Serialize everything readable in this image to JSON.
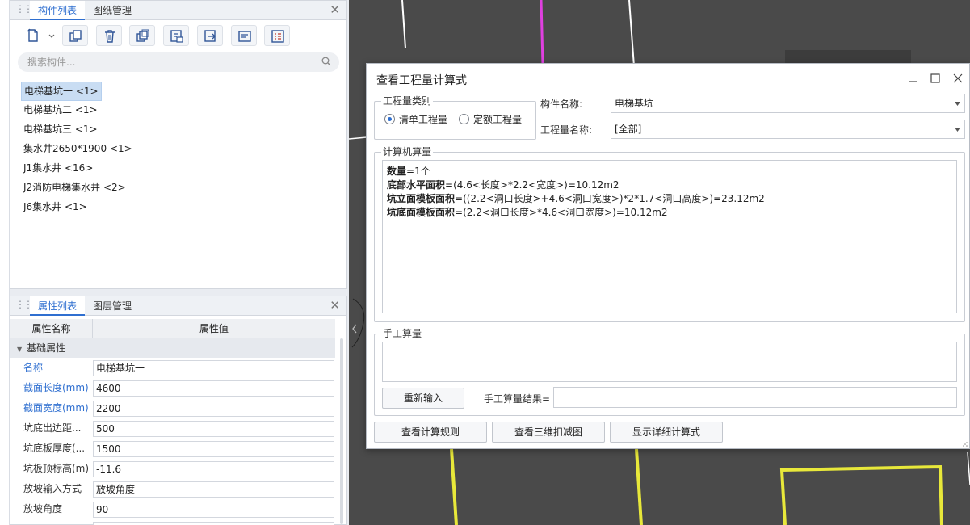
{
  "left_panel_top": {
    "tabs": [
      {
        "label": "构件列表",
        "active": true
      },
      {
        "label": "图纸管理",
        "active": false
      }
    ],
    "close_glyph": "✕",
    "toolbar_icons": [
      "new-component-icon",
      "copy-icon",
      "delete-icon",
      "duplicate-icon",
      "floor-copy-icon",
      "export-icon",
      "rename-icon",
      "properties-icon"
    ],
    "search": {
      "placeholder": "搜索构件...",
      "value": ""
    },
    "components": [
      {
        "label": "电梯基坑一 <1>",
        "selected": true
      },
      {
        "label": "电梯基坑二 <1>",
        "selected": false
      },
      {
        "label": "电梯基坑三 <1>",
        "selected": false
      },
      {
        "label": "集水井2650*1900 <1>",
        "selected": false
      },
      {
        "label": "J1集水井 <16>",
        "selected": false
      },
      {
        "label": "J2消防电梯集水井 <2>",
        "selected": false
      },
      {
        "label": "J6集水井 <1>",
        "selected": false
      }
    ]
  },
  "left_panel_bottom": {
    "tabs": [
      {
        "label": "属性列表",
        "active": true
      },
      {
        "label": "图层管理",
        "active": false
      }
    ],
    "close_glyph": "✕",
    "columns": {
      "name": "属性名称",
      "value": "属性值"
    },
    "group_label": "基础属性",
    "rows": [
      {
        "name": "名称",
        "value": "电梯基坑一",
        "highlight": true
      },
      {
        "name": "截面长度(mm)",
        "value": "4600",
        "highlight": true
      },
      {
        "name": "截面宽度(mm)",
        "value": "2200",
        "highlight": true
      },
      {
        "name": "坑底出边距...",
        "value": "500",
        "highlight": false
      },
      {
        "name": "坑底板厚度(...",
        "value": "1500",
        "highlight": false
      },
      {
        "name": "坑板顶标高(m)",
        "value": "-11.6",
        "highlight": false
      },
      {
        "name": "放坡输入方式",
        "value": "放坡角度",
        "highlight": false
      },
      {
        "name": "放坡角度",
        "value": "90",
        "highlight": false
      },
      {
        "name": "",
        "value": "",
        "highlight": false
      }
    ]
  },
  "dialog": {
    "title": "查看工程量计算式",
    "window_controls": [
      "minimize-icon",
      "maximize-icon",
      "close-icon"
    ],
    "quantity_type": {
      "legend": "工程量类别",
      "options": [
        {
          "label": "清单工程量",
          "checked": true
        },
        {
          "label": "定额工程量",
          "checked": false
        }
      ]
    },
    "component_name": {
      "label": "构件名称:",
      "value": "电梯基坑一"
    },
    "quantity_name": {
      "label": "工程量名称:",
      "value": "[全部]"
    },
    "computer_calc": {
      "legend": "计算机算量",
      "lines": [
        {
          "key": "数量",
          "formula": "=1个"
        },
        {
          "key": "底部水平面积",
          "formula": "=(4.6<长度>*2.2<宽度>)=10.12m2"
        },
        {
          "key": "坑立面模板面积",
          "formula": "=((2.2<洞口长度>+4.6<洞口宽度>)*2*1.7<洞口高度>)=23.12m2"
        },
        {
          "key": "坑底面模板面积",
          "formula": "=(2.2<洞口长度>*4.6<洞口宽度>)=10.12m2"
        }
      ]
    },
    "manual_calc": {
      "legend": "手工算量",
      "reenter_label": "重新输入",
      "result_label": "手工算量结果=",
      "result_value": ""
    },
    "buttons": {
      "view_rules": "查看计算规则",
      "view_3d": "查看三维扣减图",
      "show_detail": "显示详细计算式"
    }
  },
  "colors": {
    "accent": "#2f6fd0",
    "canvas_bg": "#4a4a4a",
    "canvas_line_white": "#ffffff",
    "canvas_line_magenta": "#e040e0",
    "canvas_line_yellow": "#e8e83a",
    "selection_bg": "#c9ddf3"
  }
}
